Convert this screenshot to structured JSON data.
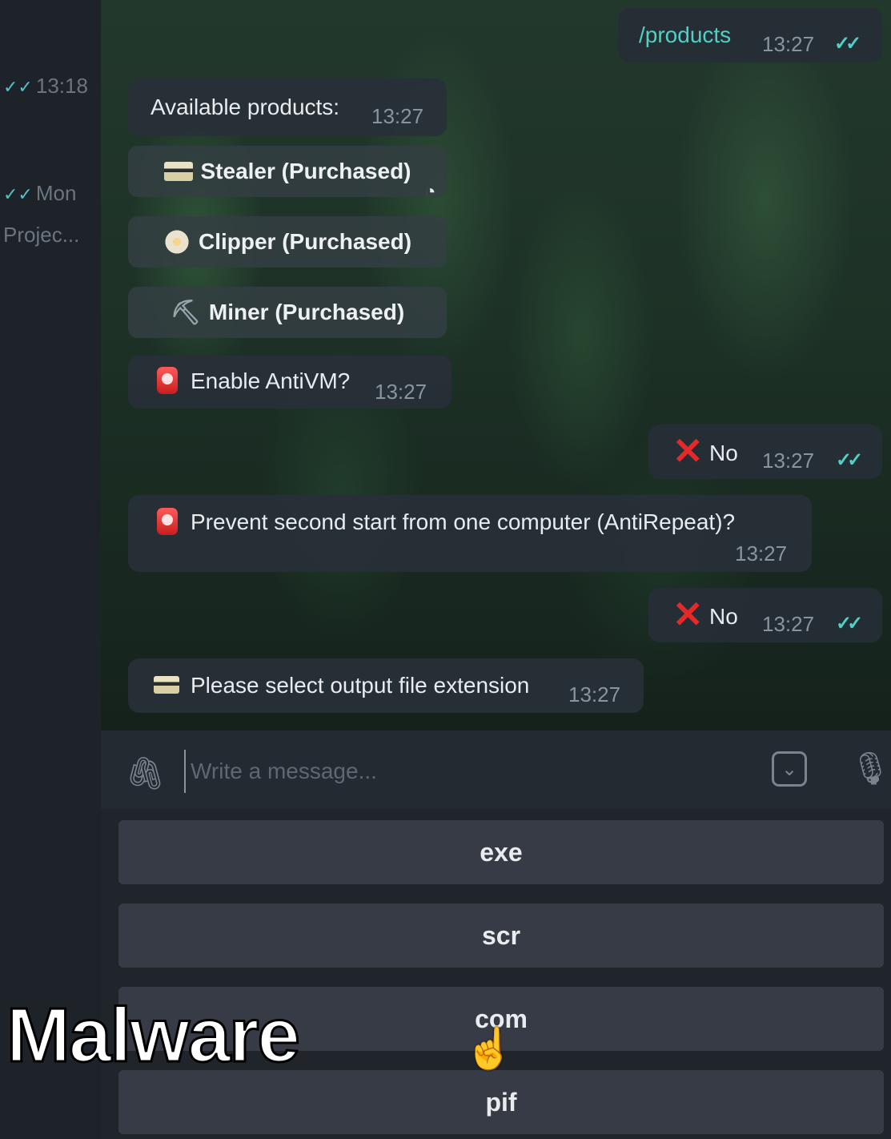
{
  "sidebar": {
    "items": [
      {
        "time": "13:18"
      },
      {
        "time": "Mon",
        "preview": "Projec..."
      }
    ]
  },
  "messages": [
    {
      "text": "/products",
      "time": "13:27",
      "direction": "out",
      "color": "#4fd1c5"
    },
    {
      "text": "Available products:",
      "time": "13:27",
      "direction": "in"
    },
    {
      "text": "Enable AntiVM?",
      "time": "13:27",
      "direction": "in"
    },
    {
      "text": "No",
      "time": "13:27",
      "direction": "out"
    },
    {
      "text": "Prevent second start from one computer (AntiRepeat)?",
      "time": "13:27",
      "direction": "in"
    },
    {
      "text": "No",
      "time": "13:27",
      "direction": "out"
    },
    {
      "text": "Please select output file extension",
      "time": "13:27",
      "direction": "in"
    }
  ],
  "inline_buttons": [
    {
      "label": "Stealer (Purchased)",
      "icon": "credit-card-icon"
    },
    {
      "label": "Clipper (Purchased)",
      "icon": "flower-icon"
    },
    {
      "label": "Miner (Purchased)",
      "icon": "pickaxe-icon"
    }
  ],
  "composer": {
    "placeholder": "Write a message..."
  },
  "reply_keyboard": {
    "options": [
      "exe",
      "scr",
      "com",
      "pif"
    ]
  },
  "overlay": {
    "label": "Malware"
  },
  "colors": {
    "accent": "#4fd1c5",
    "bubble": "#283038",
    "keyboard_button": "#363b45",
    "red_x": "#e62828"
  }
}
